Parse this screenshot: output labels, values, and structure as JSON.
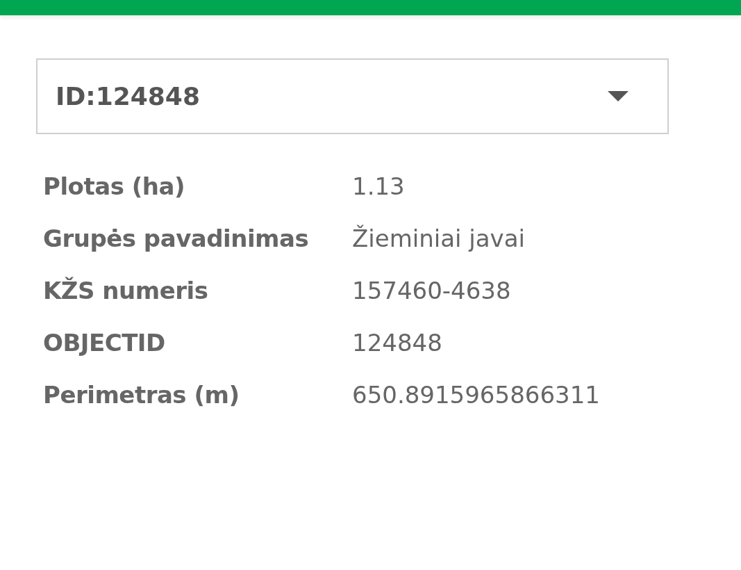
{
  "selector": {
    "value": "ID:124848"
  },
  "attributes": [
    {
      "label": "Plotas (ha)",
      "value": "1.13"
    },
    {
      "label": "Grupės pavadinimas",
      "value": "Žieminiai javai"
    },
    {
      "label": "KŽS numeris",
      "value": "157460-4638"
    },
    {
      "label": "OBJECTID",
      "value": "124848"
    },
    {
      "label": "Perimetras (m)",
      "value": "650.8915965866311"
    }
  ]
}
